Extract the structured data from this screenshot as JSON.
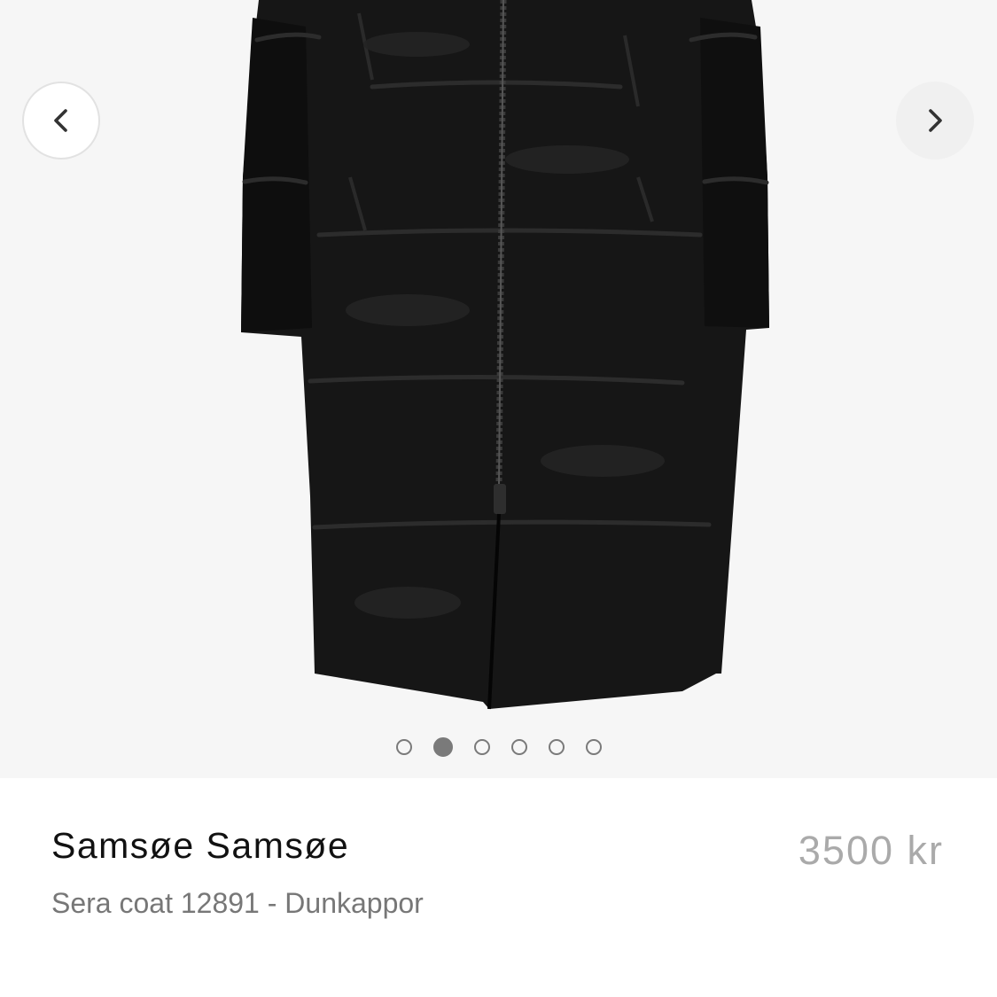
{
  "gallery": {
    "prev_icon": "chevron-left-icon",
    "next_icon": "chevron-right-icon",
    "dot_count": 6,
    "active_dot": 2
  },
  "product": {
    "brand": "Samsøe Samsøe",
    "title": "Sera coat 12891 - Dunkappor",
    "price": "3500 kr"
  },
  "colors": {
    "gallery_background": "#f6f6f6",
    "coat": "#141414",
    "price": "#aaaaaa",
    "subtitle": "#777777"
  }
}
